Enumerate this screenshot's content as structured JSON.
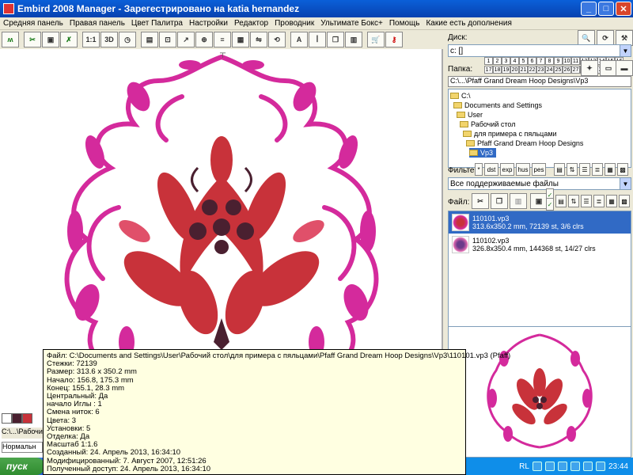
{
  "window": {
    "title": "Embird 2008 Manager - Зарегестрировано на katia hernandez"
  },
  "menu": [
    "Средняя панель",
    "Правая панель",
    "Цвет Палитра",
    "Настройки",
    "Редактор",
    "Проводник",
    "Ультимате Бокс+",
    "Помощь",
    "Какие есть дополнения"
  ],
  "toolbar": {
    "icons": [
      "wave-icon",
      "scissors-icon",
      "camera-icon",
      "cut-icon",
      "1to1-icon",
      "3d-icon",
      "clock-icon",
      "text-icon",
      "image-icon",
      "select-icon",
      "arrow-icon",
      "zoom-icon",
      "text-a-icon",
      "cart-icon",
      "key-icon"
    ],
    "labels": {
      "one": "1:1",
      "three": "3D",
      "letter": "A"
    }
  },
  "right_panel": {
    "disk_label": "Диск:",
    "disk_value": "c: []",
    "folder_label": "Папка:",
    "numbers": [
      "1",
      "2",
      "3",
      "4",
      "5",
      "6",
      "7",
      "8",
      "9",
      "10",
      "11",
      "12",
      "13",
      "14",
      "15",
      "16",
      "17",
      "18",
      "19",
      "20",
      "21",
      "22",
      "23",
      "24",
      "25",
      "26",
      "27",
      "28",
      "29",
      "30",
      "31",
      "32"
    ],
    "path": "C:\\...\\Pfaff Grand Dream Hoop Designs\\Vp3",
    "tree": [
      "C:\\",
      "Documents and Settings",
      "User",
      "Рабочий стол",
      "для примера с пяльцами",
      "Pfaff Grand Dream Hoop Designs",
      "Vp3"
    ],
    "filter_label": "Фильтер:",
    "filter_buttons": [
      "dst",
      "exp",
      "hus",
      "pes"
    ],
    "filter_value": "Все поддерживаемые файлы",
    "file_label": "Файл:",
    "files": [
      {
        "name": "110101.vp3",
        "info": "313.6x350.2 mm, 72139 st, 3/6 clrs"
      },
      {
        "name": "110102.vp3",
        "info": "326.8x350.4 mm, 144368 st, 14/27 clrs"
      }
    ]
  },
  "tooltip": [
    "Файл: C:\\Documents and Settings\\User\\Рабочий стол\\для примера с пяльцами\\Pfaff Grand Dream Hoop Designs\\Vp3\\110101.vp3 (Pfaff)",
    "Стежки: 72139",
    "Размер: 313.6 x 350.2 mm",
    "Начало: 156.8, 175.3 mm",
    "Конец: 155.1, 28.3 mm",
    "Центральный: Да",
    "начало Иглы : 1",
    "Смена ниток: 6",
    "Цвета: 3",
    "Установки: 5",
    "Отделка: Да",
    "Масштаб 1:1.6",
    "Созданный: 24. Апрель 2013, 16:34:10",
    "Модифицированный: 7. Август 2007, 12:51:26",
    "Полученный доступ: 24. Апрель 2013, 16:34:10"
  ],
  "bottom": {
    "path": "C:\\...\\Рабочий",
    "tab": "Нормальн"
  },
  "taskbar": {
    "start": "пуск",
    "lang": "RL",
    "clock": "23:44"
  },
  "colors": {
    "magenta": "#d42a9c",
    "red": "#c8323a",
    "dark": "#4a2030",
    "selection": "#316ac5"
  }
}
